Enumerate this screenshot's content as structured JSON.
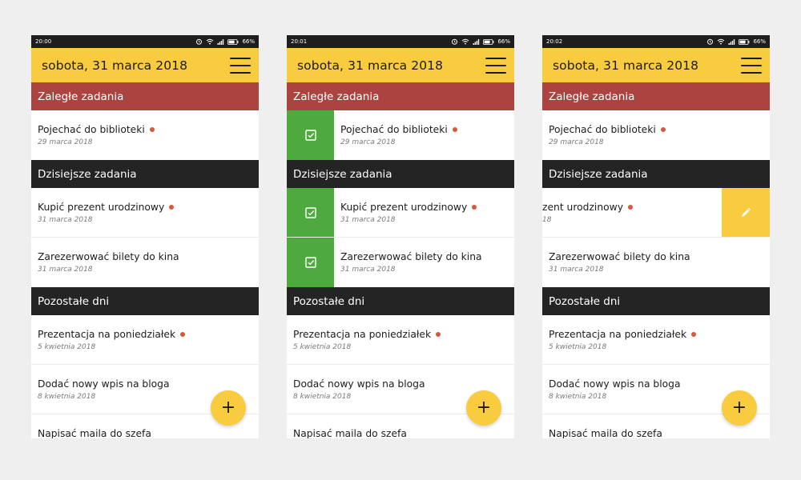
{
  "colors": {
    "accent": "#f9cb3e",
    "overdue_header": "#ab4441",
    "dark_header": "#242424",
    "complete_green": "#4ea93f",
    "priority_dot": "#d7583a"
  },
  "app": {
    "title": "sobota, 31 marca 2018",
    "menu_icon": "hamburger-menu-icon",
    "fab_label": "+"
  },
  "sections": {
    "overdue": "Zaległe zadania",
    "today": "Dzisiejsze zadania",
    "other": "Pozostałe dni"
  },
  "tasks": [
    {
      "title": "Pojechać do biblioteki",
      "date": "29 marca 2018",
      "priority": true
    },
    {
      "title": "Kupić prezent urodzinowy",
      "date": "31 marca 2018",
      "priority": true
    },
    {
      "title": "Zarezerwować bilety do kina",
      "date": "31 marca 2018",
      "priority": false
    },
    {
      "title": "Prezentacja na poniedziałek",
      "date": "5 kwietnia 2018",
      "priority": true
    },
    {
      "title": "Dodać nowy wpis na bloga",
      "date": "8 kwietnia 2018",
      "priority": false
    },
    {
      "title": "Napisać maila do szefa",
      "date": "",
      "priority": false
    }
  ],
  "screens": [
    {
      "time": "20:00",
      "battery": "66%"
    },
    {
      "time": "20:01",
      "battery": "66%"
    },
    {
      "time": "20:02",
      "battery": "66%"
    }
  ],
  "screen3_partial": {
    "title": "zent urodzinowy",
    "date": "18"
  }
}
